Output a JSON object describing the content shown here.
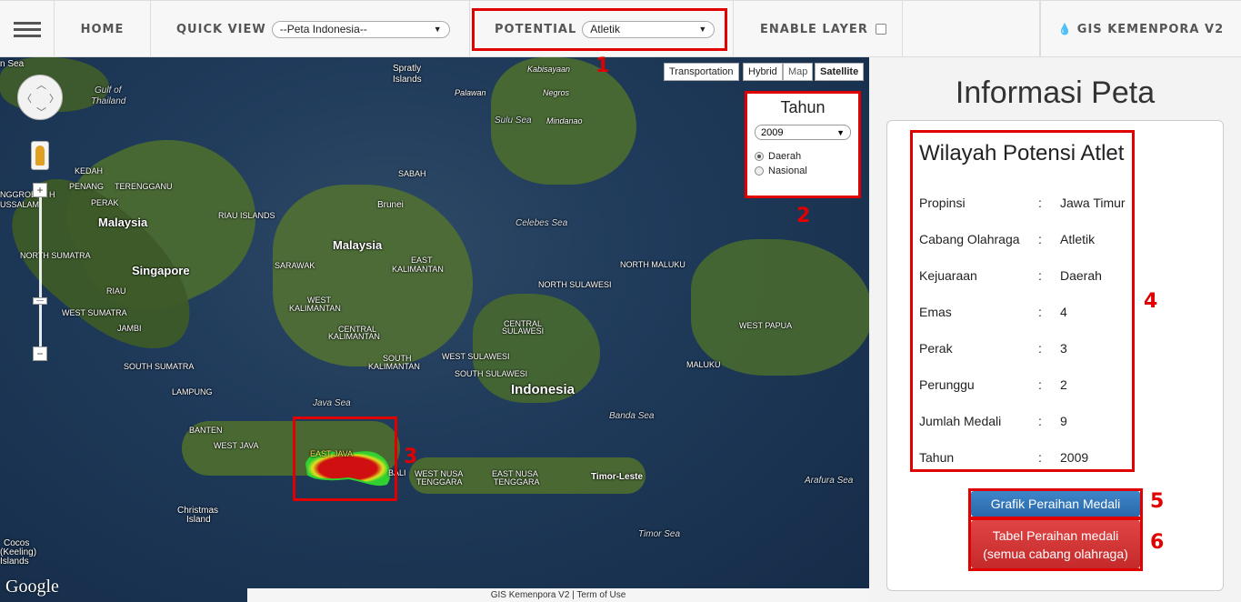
{
  "navbar": {
    "home": "HOME",
    "quick_view_label": "QUICK VIEW",
    "quick_view_value": "--Peta Indonesia--",
    "potential_label": "POTENTIAL",
    "potential_value": "Atletik",
    "enable_layer": "ENABLE LAYER",
    "brand_icon": "drop-icon",
    "brand": "GIS KEMENPORA V2"
  },
  "map": {
    "map_types": [
      "Transportation",
      "Hybrid",
      "Map",
      "Satellite"
    ],
    "active_type": "Satellite",
    "tahun_title": "Tahun",
    "tahun_value": "2009",
    "radio_daerah": "Daerah",
    "radio_nasional": "Nasional",
    "selected_radio": "Daerah",
    "labels": {
      "sea": "n Sea",
      "spratly": "Spratly",
      "spratly2": "Islands",
      "gulf": "Gulf of",
      "gulf2": "Thailand",
      "kabisayaan": "Kabisayaan",
      "palawan": "Palawan",
      "negros": "Negros",
      "sulu": "Sulu Sea",
      "mindanao": "Mindanao",
      "kedah": "KEDAH",
      "penang": "PENANG",
      "terengganu": "TERENGGANU",
      "perak": "PERAK",
      "sabah": "SABAH",
      "brunei": "Brunei",
      "nggroe": "NGGROE",
      "nggroe2": "H",
      "ussalam": "USSALAM",
      "malaysia_w": "Malaysia",
      "riau_islands": "RIAU ISLANDS",
      "celebes": "Celebes Sea",
      "malaysia_e": "Malaysia",
      "north_sumatra": "NORTH SUMATRA",
      "sarawak": "SARAWAK",
      "east_kalimantan": "EAST",
      "east_kalimantan2": "KALIMANTAN",
      "north_maluku": "NORTH MALUKU",
      "singapore": "Singapore",
      "north_sulawesi": "NORTH SULAWESI",
      "riau": "RIAU",
      "west_kalimantan": "WEST",
      "west_kalimantan2": "KALIMANTAN",
      "west_sumatra": "WEST SUMATRA",
      "jambi": "JAMBI",
      "central_kalimantan": "CENTRAL",
      "central_kalimantan2": "KALIMANTAN",
      "central_sulawesi": "CENTRAL",
      "central_sulawesi2": "SULAWESI",
      "west_papua": "WEST PAPUA",
      "south_kalimantan": "SOUTH",
      "south_kalimantan2": "KALIMANTAN",
      "west_sulawesi": "WEST SULAWESI",
      "south_sumatra": "SOUTH SUMATRA",
      "south_sulawesi": "SOUTH SULAWESI",
      "maluku": "MALUKU",
      "lampung": "LAMPUNG",
      "indonesia": "Indonesia",
      "java_sea": "Java Sea",
      "banda_sea": "Banda Sea",
      "banten": "BANTEN",
      "west_java": "WEST JAVA",
      "east_java": "EAST JAVA",
      "bali": "BALI",
      "west_nusa": "WEST NUSA",
      "west_nusa2": "TENGGARA",
      "east_nusa": "EAST NUSA",
      "east_nusa2": "TENGGARA",
      "timor_leste": "Timor-Leste",
      "arafura": "Arafura Sea",
      "christmas": "Christmas",
      "christmas2": "Island",
      "timor_sea": "Timor Sea",
      "cocos": "Cocos",
      "cocos2": "(Keeling)",
      "cocos3": "Islands"
    },
    "google": "Google",
    "footer": "GIS Kemenpora V2 | Term of Use"
  },
  "annotations": [
    "1",
    "2",
    "3",
    "4",
    "5",
    "6"
  ],
  "side": {
    "title": "Informasi Peta",
    "info_title": "Wilayah Potensi Atlet",
    "rows": [
      {
        "label": "Propinsi",
        "colon": ":",
        "value": "Jawa Timur"
      },
      {
        "label": "Cabang Olahraga",
        "colon": ":",
        "value": "Atletik"
      },
      {
        "label": "Kejuaraan",
        "colon": ":",
        "value": "Daerah"
      },
      {
        "label": "Emas",
        "colon": ":",
        "value": "4"
      },
      {
        "label": "Perak",
        "colon": ":",
        "value": "3"
      },
      {
        "label": "Perunggu",
        "colon": ":",
        "value": "2"
      },
      {
        "label": "Jumlah Medali",
        "colon": ":",
        "value": "9"
      },
      {
        "label": "Tahun",
        "colon": ":",
        "value": "2009"
      }
    ],
    "btn_grafik": "Grafik Peraihan Medali",
    "btn_tabel_line1": "Tabel Peraihan medali",
    "btn_tabel_line2": "(semua cabang olahraga)"
  }
}
